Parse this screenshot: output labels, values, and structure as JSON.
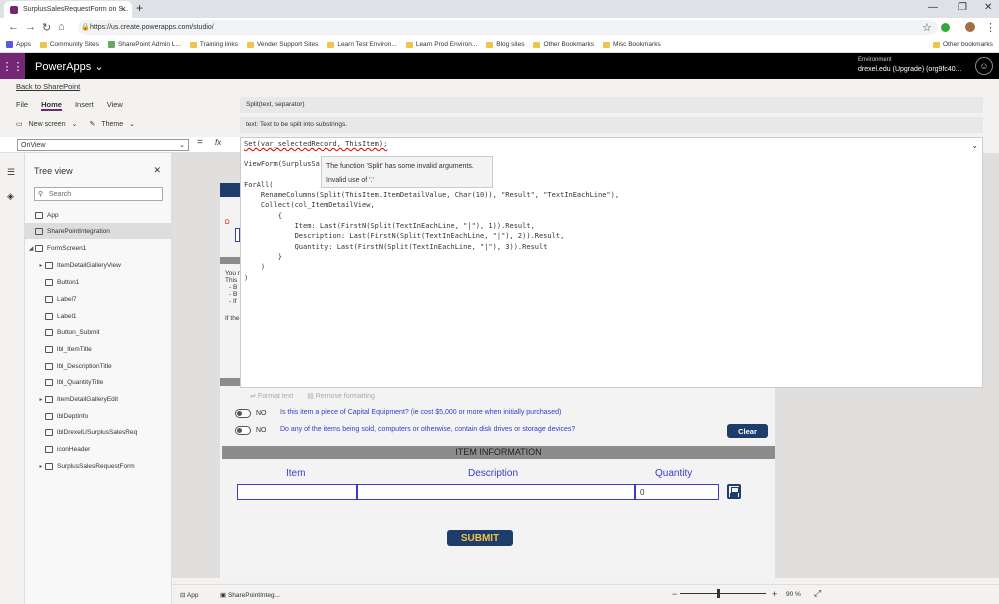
{
  "browser": {
    "tab_title": "SurplusSalesRequestForm on S...",
    "close": "×",
    "new_tab": "+",
    "url": "https://us.create.powerapps.com/studio/",
    "bookmarks": [
      "Apps",
      "Community Sites",
      "SharePoint Admin L...",
      "Training links",
      "Vender Support Sites",
      "Learn Test Environ...",
      "Learn Prod Environ...",
      "Blog sites",
      "Other Bookmarks",
      "Misc Bookmarks"
    ],
    "other_bookmarks": "Other bookmarks"
  },
  "header": {
    "app_title": "PowerApps",
    "env_label": "Environment",
    "env_value": "drexel.edu (Upgrade) (org9fc40..."
  },
  "studio": {
    "back_link": "Back to SharePoint",
    "menus": [
      "File",
      "Home",
      "Insert",
      "View"
    ],
    "active_menu": "Home",
    "new_screen": "New screen",
    "theme": "Theme",
    "property": "OnView",
    "equals": "=",
    "fx": "fx"
  },
  "tree": {
    "title": "Tree view",
    "search_placeholder": "Search",
    "items": [
      {
        "label": "App"
      },
      {
        "label": "SharePointIntegration"
      },
      {
        "label": "FormScreen1"
      },
      {
        "label": "ItemDetailGalleryView"
      },
      {
        "label": "Button1"
      },
      {
        "label": "Label7"
      },
      {
        "label": "Label1"
      },
      {
        "label": "Button_Submit"
      },
      {
        "label": "lbl_ItemTitle"
      },
      {
        "label": "lbl_DescriptionTitle"
      },
      {
        "label": "lbl_QuantityTitle"
      },
      {
        "label": "ItemDetailGalleryEdit"
      },
      {
        "label": "lblDeptInfo"
      },
      {
        "label": "lblDrexelUSurplusSalesReq"
      },
      {
        "label": "iconHeader"
      },
      {
        "label": "SurplusSalesRequestForm"
      }
    ]
  },
  "editor": {
    "signature": "Split(text, separator)",
    "param_hint": "text: Text to be split into substrings.",
    "lines": [
      "Set(var_selectedRecord, ThisItem);",
      "",
      "ViewForm(SurplusSa",
      "",
      "ForAll(",
      "    RenameColumns(Split(ThisItem.ItemDetailValue, Char(10)), \"Result\", \"TextInEachLine\"),",
      "    Collect(col_ItemDetailView,",
      "        {",
      "            Item: Last(FirstN(Split(TextInEachLine, \"|\"), 1)).Result,",
      "            Description: Last(FirstN(Split(TextInEachLine, \"|\"), 2)).Result,",
      "            Quantity: Last(FirstN(Split(TextInEachLine, \"|\"), 3)).Result",
      "        }",
      "    )",
      ")"
    ],
    "tooltip_line1": "The function 'Split' has some invalid arguments.",
    "tooltip_line2": "Invalid use of '.'",
    "format_text": "Format text",
    "remove_formatting": "Remove formatting"
  },
  "form": {
    "q1": "Is this item a piece of Capital Equipment? (ie cost $5,000 or more when initially purchased)",
    "q2": "Do any of the items being sold, computers or otherwise, contain disk drives or storage devices?",
    "no": "NO",
    "clear": "Clear",
    "section": "ITEM INFORMATION",
    "col_item": "Item",
    "col_description": "Description",
    "col_quantity": "Quantity",
    "quantity_value": "0",
    "submit": "SUBMIT",
    "left_snippets": [
      "You n",
      "This",
      "- B",
      "- B",
      "- If",
      "If the"
    ]
  },
  "status": {
    "app": "App",
    "screen": "SharePointInteg...",
    "zoom": "90 %"
  }
}
